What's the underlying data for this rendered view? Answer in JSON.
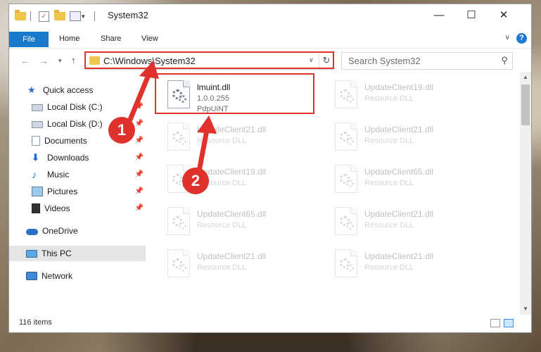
{
  "window": {
    "title": "System32",
    "controls": {
      "minimize": "—",
      "maximize": "☐",
      "close": "✕"
    }
  },
  "ribbon": {
    "tabs": [
      "File",
      "Home",
      "Share",
      "View"
    ],
    "help": "?"
  },
  "navigation": {
    "back": "←",
    "forward": "→",
    "recent": "▾",
    "up": "↑",
    "address": "C:\\Windows\\System32",
    "refresh": "↻",
    "search_placeholder": "Search System32"
  },
  "sidebar": {
    "items": [
      {
        "label": "Quick access",
        "icon": "star-icon",
        "pinned": false
      },
      {
        "label": "Local Disk (C:)",
        "icon": "drive-icon",
        "pinned": true
      },
      {
        "label": "Local Disk (D:)",
        "icon": "drive-icon",
        "pinned": true
      },
      {
        "label": "Documents",
        "icon": "documents-icon",
        "pinned": true
      },
      {
        "label": "Downloads",
        "icon": "downloads-icon",
        "pinned": true
      },
      {
        "label": "Music",
        "icon": "music-icon",
        "pinned": true
      },
      {
        "label": "Pictures",
        "icon": "pictures-icon",
        "pinned": true
      },
      {
        "label": "Videos",
        "icon": "videos-icon",
        "pinned": true
      },
      {
        "label": "OneDrive",
        "icon": "onedrive-icon",
        "pinned": false
      },
      {
        "label": "This PC",
        "icon": "this-pc-icon",
        "pinned": false,
        "selected": true
      },
      {
        "label": "Network",
        "icon": "network-icon",
        "pinned": false
      }
    ]
  },
  "files": [
    {
      "name": "lmuint.dll",
      "line2": "1.0.0.255",
      "line3": "PdpUiNT",
      "highlighted": true
    },
    {
      "name": "UpdateClient19.dll",
      "line2": "Resource DLL",
      "faded": true
    },
    {
      "name": "UpdateClient21.dll",
      "line2": "Resource DLL",
      "faded": true
    },
    {
      "name": "UpdateClient21.dll",
      "line2": "Resource DLL",
      "faded": true
    },
    {
      "name": "UpdateClient19.dll",
      "line2": "Resource DLL",
      "faded": true
    },
    {
      "name": "UpdateClient65.dll",
      "line2": "Resource DLL",
      "faded": true
    },
    {
      "name": "UpdateClient65.dll",
      "line2": "Resource DLL",
      "faded": true
    },
    {
      "name": "UpdateClient21.dll",
      "line2": "Resource DLL",
      "faded": true
    },
    {
      "name": "UpdateClient21.dll",
      "line2": "Resource DLL",
      "faded": true
    },
    {
      "name": "UpdateClient21.dll",
      "line2": "Resource DLL",
      "faded": true
    }
  ],
  "status": {
    "item_count": "116 items"
  },
  "annotations": {
    "step1": "1",
    "step2": "2",
    "color": "#e0312c"
  }
}
